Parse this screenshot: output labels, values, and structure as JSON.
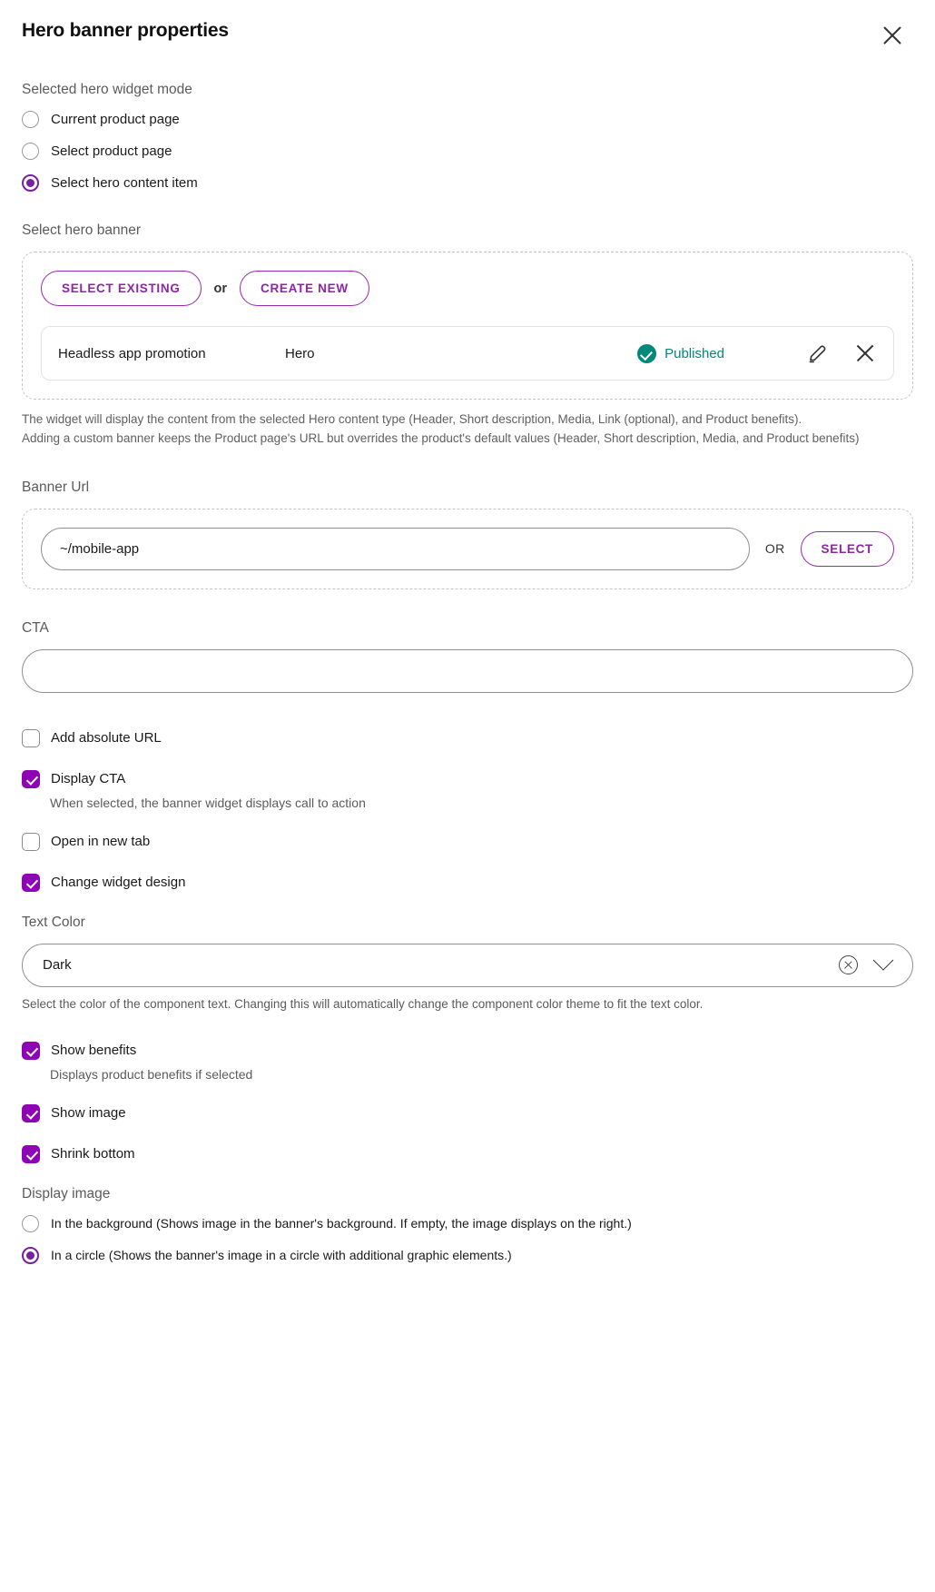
{
  "header": {
    "title": "Hero banner properties",
    "close_icon": "close-icon"
  },
  "widget_mode": {
    "label": "Selected hero widget mode",
    "options": [
      {
        "label": "Current product page",
        "checked": false
      },
      {
        "label": "Select product page",
        "checked": false
      },
      {
        "label": "Select hero content item",
        "checked": true
      }
    ]
  },
  "hero_banner": {
    "label": "Select hero banner",
    "select_existing_label": "SELECT EXISTING",
    "or_label": "or",
    "create_new_label": "CREATE NEW",
    "item": {
      "name": "Headless app promotion",
      "type": "Hero",
      "status": "Published",
      "status_color": "#00897b",
      "edit_icon": "pencil-icon",
      "remove_icon": "close-icon"
    },
    "helper_line_1": "The widget will display the content from the selected Hero content type (Header, Short description, Media, Link (optional), and Product benefits).",
    "helper_line_2": "Adding a custom banner keeps the Product page's URL but overrides the product's default values (Header, Short description, Media, and Product benefits)"
  },
  "banner_url": {
    "label": "Banner Url",
    "value": "~/mobile-app",
    "placeholder": "",
    "or_label": "OR",
    "select_label": "SELECT"
  },
  "cta": {
    "label": "CTA",
    "value": "",
    "placeholder": ""
  },
  "checkboxes": {
    "add_absolute_url": {
      "label": "Add absolute URL",
      "checked": false
    },
    "display_cta": {
      "label": "Display CTA",
      "checked": true,
      "help": "When selected, the banner widget displays call to action"
    },
    "open_in_new_tab": {
      "label": "Open in new tab",
      "checked": false
    },
    "change_widget_design": {
      "label": "Change widget design",
      "checked": true
    },
    "show_benefits": {
      "label": "Show benefits",
      "checked": true,
      "help": "Displays product benefits if selected"
    },
    "show_image": {
      "label": "Show image",
      "checked": true
    },
    "shrink_bottom": {
      "label": "Shrink bottom",
      "checked": true
    }
  },
  "text_color": {
    "label": "Text Color",
    "value": "Dark",
    "clear_icon": "clear-circle-icon",
    "chevron_icon": "chevron-down-icon",
    "help": "Select the color of the component text. Changing this will automatically change the component color theme to fit the text color."
  },
  "display_image": {
    "label": "Display image",
    "options": [
      {
        "label": "In the background (Shows image in the banner's background. If empty, the image displays on the right.)",
        "checked": false
      },
      {
        "label": "In a circle (Shows the banner's image in a circle with additional graphic elements.)",
        "checked": true
      }
    ]
  },
  "theme": {
    "accent": "#8e03b5",
    "accent_outline": "#9c27b0",
    "status_teal": "#00897b"
  }
}
